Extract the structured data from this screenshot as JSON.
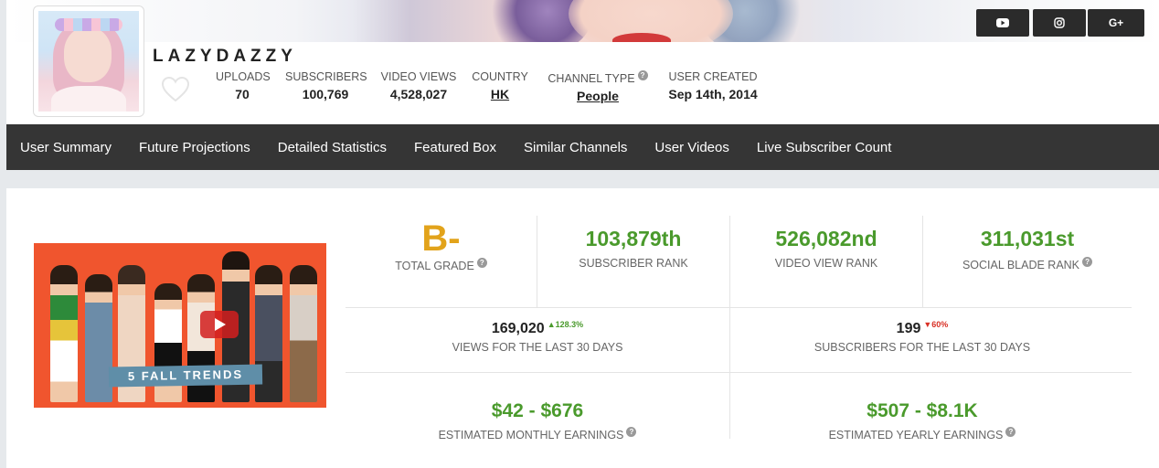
{
  "social": {
    "youtube": "youtube-icon",
    "instagram": "instagram-icon",
    "google_plus_label": "G+"
  },
  "channel": {
    "name": "LAZYDAZZY",
    "stats": [
      {
        "label": "UPLOADS",
        "value": "70"
      },
      {
        "label": "SUBSCRIBERS",
        "value": "100,769"
      },
      {
        "label": "VIDEO VIEWS",
        "value": "4,528,027"
      },
      {
        "label": "COUNTRY",
        "value": "HK"
      },
      {
        "label": "CHANNEL TYPE",
        "value": "People"
      },
      {
        "label": "USER CREATED",
        "value": "Sep 14th, 2014"
      }
    ]
  },
  "nav": [
    "User Summary",
    "Future Projections",
    "Detailed Statistics",
    "Featured Box",
    "Similar Channels",
    "User Videos",
    "Live Subscriber Count"
  ],
  "summary": {
    "grade": {
      "value": "B-",
      "label": "TOTAL GRADE"
    },
    "subscriber_rank": {
      "value": "103,879th",
      "label": "SUBSCRIBER RANK"
    },
    "video_view_rank": {
      "value": "526,082nd",
      "label": "VIDEO VIEW RANK"
    },
    "socialblade_rank": {
      "value": "311,031st",
      "label": "SOCIAL BLADE RANK"
    },
    "views_30": {
      "value": "169,020",
      "change": "128.3%",
      "label": "VIEWS FOR THE LAST 30 DAYS"
    },
    "subs_30": {
      "value": "199",
      "change": "60%",
      "label": "SUBSCRIBERS FOR THE LAST 30 DAYS"
    },
    "monthly": {
      "value": "$42 - $676",
      "label": "ESTIMATED MONTHLY EARNINGS"
    },
    "yearly": {
      "value": "$507 - $8.1K",
      "label": "ESTIMATED YEARLY EARNINGS"
    }
  },
  "video": {
    "thumbnail_text": "5 FALL TRENDS"
  },
  "colors": {
    "nav_bg": "#353535",
    "green": "#4a9a2c",
    "grade": "#e2a31b",
    "up": "#4a9a2c",
    "down": "#d93025"
  }
}
